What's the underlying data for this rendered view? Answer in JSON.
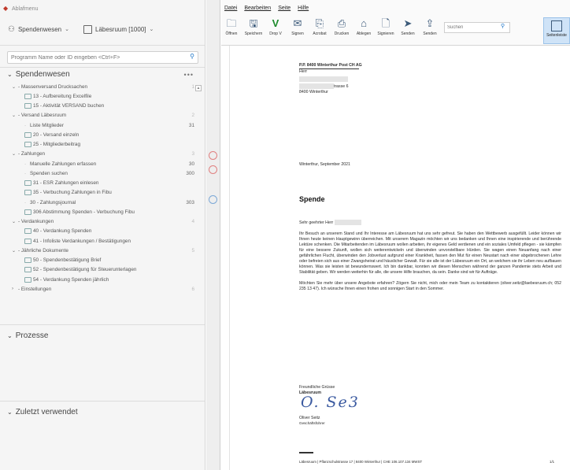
{
  "app": {
    "menu_label": "Ablaf­menu"
  },
  "context": {
    "group": "Spendenwesen",
    "library": "Läbesruum [1000]"
  },
  "search": {
    "placeholder": "Programm Name oder ID eingeben <Ctrl+F>"
  },
  "sidebar": {
    "section1": "Spendenwesen",
    "section2": "Prozesse",
    "section3": "Zuletzt verwendet",
    "more": "•••",
    "rows": [
      {
        "kind": "group",
        "label": "- Massenversand Drucksachen",
        "count": "1"
      },
      {
        "kind": "item",
        "label": "13 - Aufbereitung Excelfile",
        "count": ""
      },
      {
        "kind": "item",
        "label": "15 - Aktivität VERSAND buchen",
        "count": ""
      },
      {
        "kind": "group",
        "label": "- Versand Läbesruum",
        "count": "2"
      },
      {
        "kind": "sub",
        "label": "Liste Mitglieder",
        "count": "31"
      },
      {
        "kind": "item",
        "label": "20 - Versand einzeln",
        "count": ""
      },
      {
        "kind": "item",
        "label": "25 - Mitgliederbeitrag",
        "count": ""
      },
      {
        "kind": "group",
        "label": "- Zahlungen",
        "count": "3"
      },
      {
        "kind": "sub",
        "label": "Manuelle Zahlungen erfassen",
        "count": "30"
      },
      {
        "kind": "sub",
        "label": "Spenden suchen",
        "count": "300"
      },
      {
        "kind": "item",
        "label": "31 - ESR Zahlungen einlesen",
        "count": ""
      },
      {
        "kind": "item",
        "label": "35 - Verbuchung Zahlungen in Fibu",
        "count": ""
      },
      {
        "kind": "sub",
        "label": "30 - Zahlungsjournal",
        "count": "303"
      },
      {
        "kind": "item",
        "label": "306 Abstimmung Spenden - Verbuchung Fibu",
        "count": ""
      },
      {
        "kind": "group",
        "label": "- Verdankungen",
        "count": "4"
      },
      {
        "kind": "item",
        "label": "40 - Verdankung Spenden",
        "count": ""
      },
      {
        "kind": "item",
        "label": "41 - Infoliste Verdankungen / Bestätigungen",
        "count": ""
      },
      {
        "kind": "group",
        "label": "- Jährliche Dokumente",
        "count": "5"
      },
      {
        "kind": "item",
        "label": "50 - Spendenbestätigung Brief",
        "count": ""
      },
      {
        "kind": "item",
        "label": "52 - Spendenbestätigung für Steuerunterlagen",
        "count": ""
      },
      {
        "kind": "item",
        "label": "54 - Verdankung Spenden jährlich",
        "count": ""
      },
      {
        "kind": "closed",
        "label": "- Einstellungen",
        "count": "6"
      }
    ]
  },
  "menubar": [
    "Datei",
    "Bearbeiten",
    "Seite",
    "Hilfe"
  ],
  "toolbar": {
    "buttons": [
      "Öffnen",
      "Speichern",
      "Drop V",
      "Signen",
      "Acrobat",
      "Drucken",
      "Ablegen",
      "Signieren",
      "Senden",
      "Senden"
    ],
    "search_placeholder": "Suchen",
    "selected_label": "Seitenleiste"
  },
  "letter": {
    "pp_line": "P.P.  8400 Winterthur     Post CH AG",
    "salutation_line": "Herr",
    "street_suffix": "trasse 6",
    "city": "8400 Winterthur",
    "date": "Winterthur, September 2021",
    "heading": "Spende",
    "greeting": "Sehr geehrter Herr",
    "paragraph1": "Ihr Besuch an unserem Stand und Ihr Interesse am Läbesruum hat uns sehr gefreut. Sie haben den Wettbewerb ausgefüllt. Leider können wir Ihnen heute keinen Hauptgewinn überreichen. Mit unserem Magazin möchten wir uns bedanken und Ihnen eine inspirierende und berührende Lektüre schenken. Die Mitarbeitenden im Läbesruum wollen arbeiten, ihr eigenes Geld verdienen und ein soziales Umfeld pflegen - sie kämpfen für eine bessere Zukunft, wollen sich weiterentwickeln und überwinden unvorstellbare Hürden. Sie wagen einen Neuanfang nach einer gefährlichen Flucht, überwinden den Jobverlust aufgrund einer Krankheit, fassen den Mut für einen Neustart nach einer abgebrochenen Lehre oder befreien sich aus einer Zwangsheirat und häuslicher Gewalt. Für sie alle ist der Läbesruum ein Ort, an welchem sie ihr Leben neu aufbauen können. Was sie leisten ist bewundernswert. Ich bin dankbar, konnten wir diesen Menschen während der ganzen Pandemie stets Arbeit und Stabilität geben. Wir werden weiterhin für alle, die unsere Hilfe brauchen, da sein. Danke sind wir für Aufträge.",
    "paragraph2_a": "Möchten Sie mehr über unsere Angebote erfahren? Zögern Sie nicht, mich oder mein Team zu kontaktieren (",
    "email": "oliver.seitz@laebesruum.ch",
    "paragraph2_b": "; 052 235 13 47).  Ich wünsche Ihnen einen frohen und sonnigen Start in den Sommer.",
    "closing": "Freundliche Grüsse",
    "org": "Läbesruum",
    "signature": "O. Se3",
    "signer_name": "Oliver Seitz",
    "signer_title": "Geschäftsführer",
    "footer": "Läbesruum | Pflanzschulstrasse 17 | 8400 Winterthur | CHE 106.107.134 MWST",
    "page_no": "1/1"
  }
}
